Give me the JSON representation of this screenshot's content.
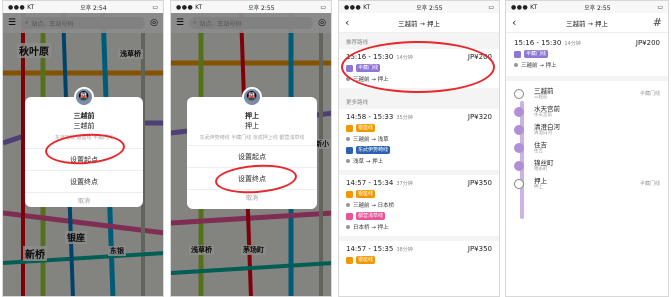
{
  "status": {
    "s1": {
      "carrier": "KT",
      "time": "오후 2:54"
    },
    "s2": {
      "carrier": "KT",
      "time": "오후 2:55"
    },
    "s3": {
      "carrier": "KT",
      "time": "오후 2:55"
    },
    "s4": {
      "carrier": "KT",
      "time": "오후 2:55"
    }
  },
  "map": {
    "search_placeholder": "站点、车站号码",
    "labels1": [
      "秋叶原",
      "浅草桥",
      "新桥",
      "银座",
      "东银"
    ],
    "labels2": [
      "浅草桥",
      "茅场町",
      "新小"
    ]
  },
  "popup1": {
    "name": "三越前",
    "name2": "三越前",
    "lines": "东京地铁 银座线 半藏门线",
    "set_start": "设置起点",
    "set_end": "设置终点",
    "cancel": "取消"
  },
  "popup2": {
    "name": "押上",
    "name2": "押上",
    "lines": "东武伊势崎线 半藏门线 京成押上线 都营浅草线",
    "set_start": "设置起点",
    "set_end": "设置终点",
    "cancel": "取消"
  },
  "routes_page": {
    "title": "三越前 → 押上",
    "recommended_label": "推荐路线",
    "more_label": "更多路线",
    "routes": [
      {
        "time": "15:16 - 15:30",
        "dur": "14分钟",
        "fare": "JP¥200",
        "tags": [
          "半藏门线"
        ],
        "legs": [
          "三越前 → 押上"
        ]
      },
      {
        "time": "14:58 - 15:33",
        "dur": "35分钟",
        "fare": "JP¥320",
        "tags": [
          "银座线",
          "东武伊势崎线"
        ],
        "legs": [
          "三越前 → 浅草",
          "浅草 → 押上"
        ]
      },
      {
        "time": "14:57 - 15:34",
        "dur": "37分钟",
        "fare": "JP¥350",
        "tags": [
          "银座线",
          "都营浅草线"
        ],
        "legs": [
          "三越前 → 日本桥",
          "日本桥 → 押上"
        ]
      },
      {
        "time": "14:57 - 15:35",
        "dur": "38分钟",
        "fare": "JP¥350",
        "tags": [
          "银座线"
        ],
        "legs": []
      }
    ]
  },
  "detail_page": {
    "title": "三越前 → 押上",
    "time": "15:16 - 15:30",
    "dur": "14分钟",
    "fare": "JP¥200",
    "tag": "半藏门线",
    "leg": "三越前 → 押上",
    "stops": [
      {
        "name": "三越前",
        "sub": "三越前",
        "side": "半藏门线"
      },
      {
        "name": "水天宫前",
        "sub": "水天宫前",
        "side": ""
      },
      {
        "name": "清澄白河",
        "sub": "清澄白河",
        "side": ""
      },
      {
        "name": "住吉",
        "sub": "住吉",
        "side": ""
      },
      {
        "name": "锦丝町",
        "sub": "锦糸町",
        "side": ""
      },
      {
        "name": "押上",
        "sub": "押上",
        "side": "半藏门线"
      }
    ]
  },
  "colors": {
    "hanzomon": "#8f76d6",
    "ginza": "#f39700",
    "tobu": "#2b62b1",
    "asakusa": "#e85298",
    "red": "#e8262c"
  }
}
